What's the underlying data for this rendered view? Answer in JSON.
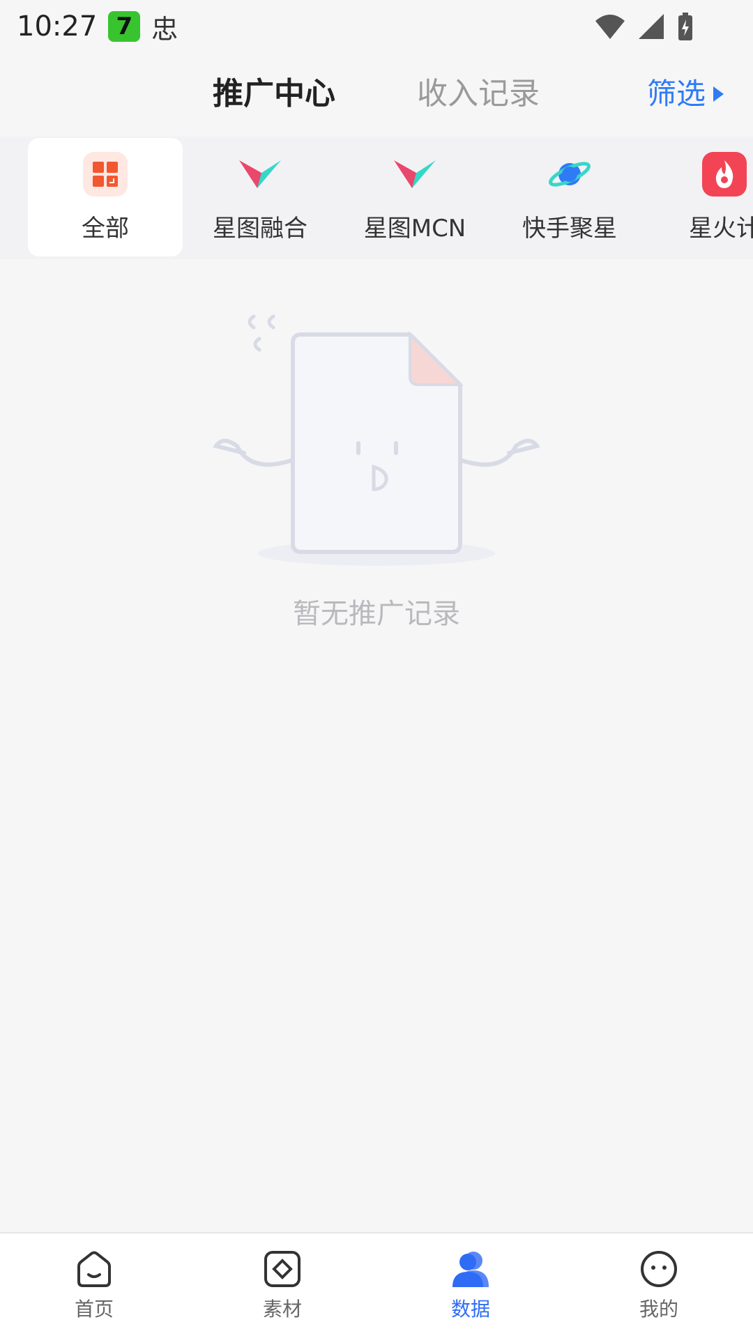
{
  "status_bar": {
    "time": "10:27",
    "app_badge": "7",
    "app_icon2": "忠",
    "icons": [
      "wifi-icon",
      "signal-icon",
      "battery-charging-icon"
    ]
  },
  "top_tabs": {
    "active": "推广中心",
    "inactive": "收入记录",
    "filter": "筛选",
    "filter_icon": "triangle-right-icon",
    "accent": "#2f7bf6"
  },
  "categories": [
    {
      "label": "全部",
      "icon": "grid-icon",
      "selected": true
    },
    {
      "label": "星图融合",
      "icon": "xingtu-logo-icon"
    },
    {
      "label": "星图MCN",
      "icon": "xingtu-logo-icon"
    },
    {
      "label": "快手聚星",
      "icon": "planet-icon"
    },
    {
      "label": "星火计",
      "icon": "flame-icon"
    }
  ],
  "empty_state": {
    "text": "暂无推广记录",
    "illustration": "empty-document-icon"
  },
  "bottom_nav": [
    {
      "label": "首页",
      "icon": "home-icon"
    },
    {
      "label": "素材",
      "icon": "material-icon"
    },
    {
      "label": "数据",
      "icon": "data-user-icon",
      "active": true
    },
    {
      "label": "我的",
      "icon": "profile-icon"
    }
  ]
}
